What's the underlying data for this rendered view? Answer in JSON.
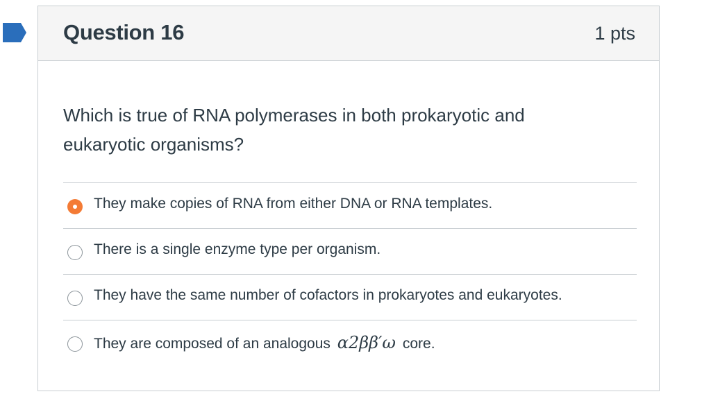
{
  "flag": {
    "icon": "bookmark-flag-icon",
    "color": "#2a6ebb"
  },
  "question": {
    "title": "Question 16",
    "points": "1 pts",
    "text": "Which is true of RNA polymerases in both prokaryotic and eukaryotic organisms?"
  },
  "answers": [
    {
      "label": "They make copies of RNA from either DNA or RNA templates.",
      "selected": true
    },
    {
      "label": "There is a single enzyme type per organism.",
      "selected": false
    },
    {
      "label": "They have the same number of cofactors in prokaryotes and eukaryotes.",
      "selected": false
    },
    {
      "label_before": "They are composed of an analogous",
      "math": "α2ββ′ω",
      "label_after": "core.",
      "selected": false
    }
  ],
  "colors": {
    "accent_selected": "#f47b35",
    "header_bg": "#f5f5f5",
    "border": "#c7cdd1",
    "text": "#2d3b45"
  }
}
